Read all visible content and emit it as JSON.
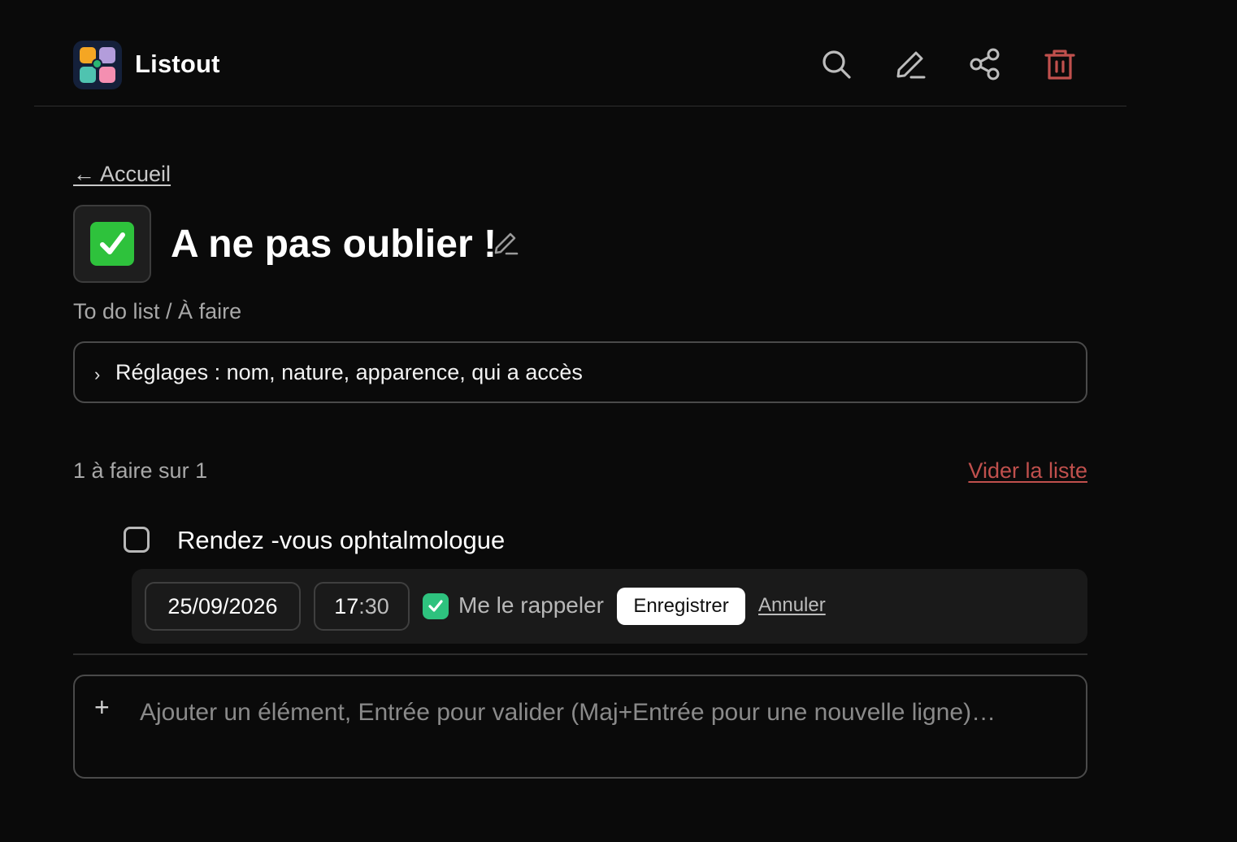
{
  "app": {
    "name": "Listout"
  },
  "header": {
    "actions": [
      {
        "icon": "search-icon"
      },
      {
        "icon": "pencil-icon"
      },
      {
        "icon": "share-icon"
      },
      {
        "icon": "trash-icon",
        "color": "#c0504d"
      }
    ]
  },
  "nav": {
    "back_label": "← Accueil"
  },
  "list": {
    "emoji": "✅",
    "title": "A ne pas oublier !",
    "subtitle": "To do list / À faire",
    "settings_label": "Réglages : nom, nature, apparence, qui a accès",
    "count_text": "1 à faire sur 1",
    "clear_label": "Vider la liste",
    "items": [
      {
        "label": "Rendez -vous ophtalmologue",
        "checked": false,
        "reminder": {
          "date": "25/09/2026",
          "time_hours": "17",
          "time_sep": ":",
          "time_minutes": "30",
          "remind_checked": true,
          "remind_label": "Me le rappeler",
          "save_label": "Enregistrer",
          "cancel_label": "Annuler"
        }
      }
    ],
    "add_placeholder": "Ajouter un élément, Entrée pour valider (Maj+Entrée pour une nouvelle ligne)…"
  },
  "colors": {
    "background": "#0a0a0a",
    "danger": "#c0504d",
    "accent_green": "#2ec27e"
  }
}
